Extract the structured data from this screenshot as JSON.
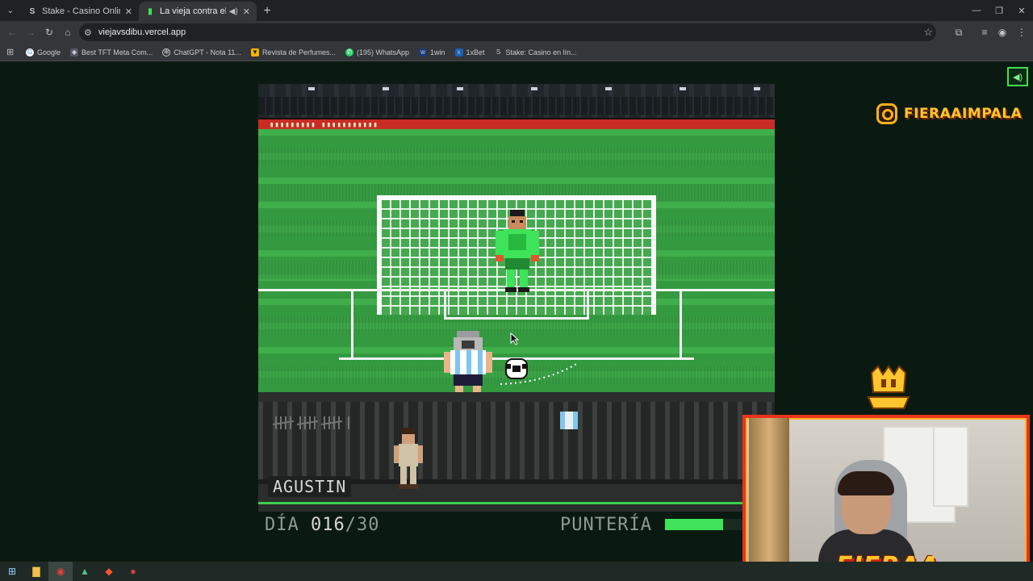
{
  "browser": {
    "tabs": [
      {
        "title": "Stake - Casino Online y Apuest",
        "icon": "stake-icon",
        "active": false
      },
      {
        "title": "La vieja contra el Dibu",
        "icon": "game-icon",
        "active": true
      }
    ],
    "url": "viejavsdibu.vercel.app",
    "bookmarks": [
      {
        "label": "Google",
        "icon": "google-icon"
      },
      {
        "label": "Best TFT Meta Com...",
        "icon": "tft-icon"
      },
      {
        "label": "ChatGPT - Nota 11...",
        "icon": "chatgpt-icon"
      },
      {
        "label": "Revista de Perfumes...",
        "icon": "perfume-icon"
      },
      {
        "label": "(195) WhatsApp",
        "icon": "whatsapp-icon"
      },
      {
        "label": "1win",
        "icon": "1win-icon"
      },
      {
        "label": "1xBet",
        "icon": "1xbet-icon"
      },
      {
        "label": "Stake: Casino en lín...",
        "icon": "stake-icon"
      }
    ]
  },
  "game": {
    "player_name": "AGUSTIN",
    "day_label": "DÍA",
    "day_current": "016",
    "day_total": "/30",
    "aim_label": "PUNTERÍA",
    "aim_level": 0.65,
    "banner_marks": "▮▮▮▮▮▮▮▮▮ ▮▮▮▮▮▮▮▮▮▮▮"
  },
  "overlay": {
    "instagram_handle": "FIERAAIMPALA",
    "brand": "FIERAA"
  },
  "colors": {
    "accent_green": "#3ee35a",
    "overlay_gold": "#ffc52e",
    "overlay_red": "#e8341c"
  }
}
